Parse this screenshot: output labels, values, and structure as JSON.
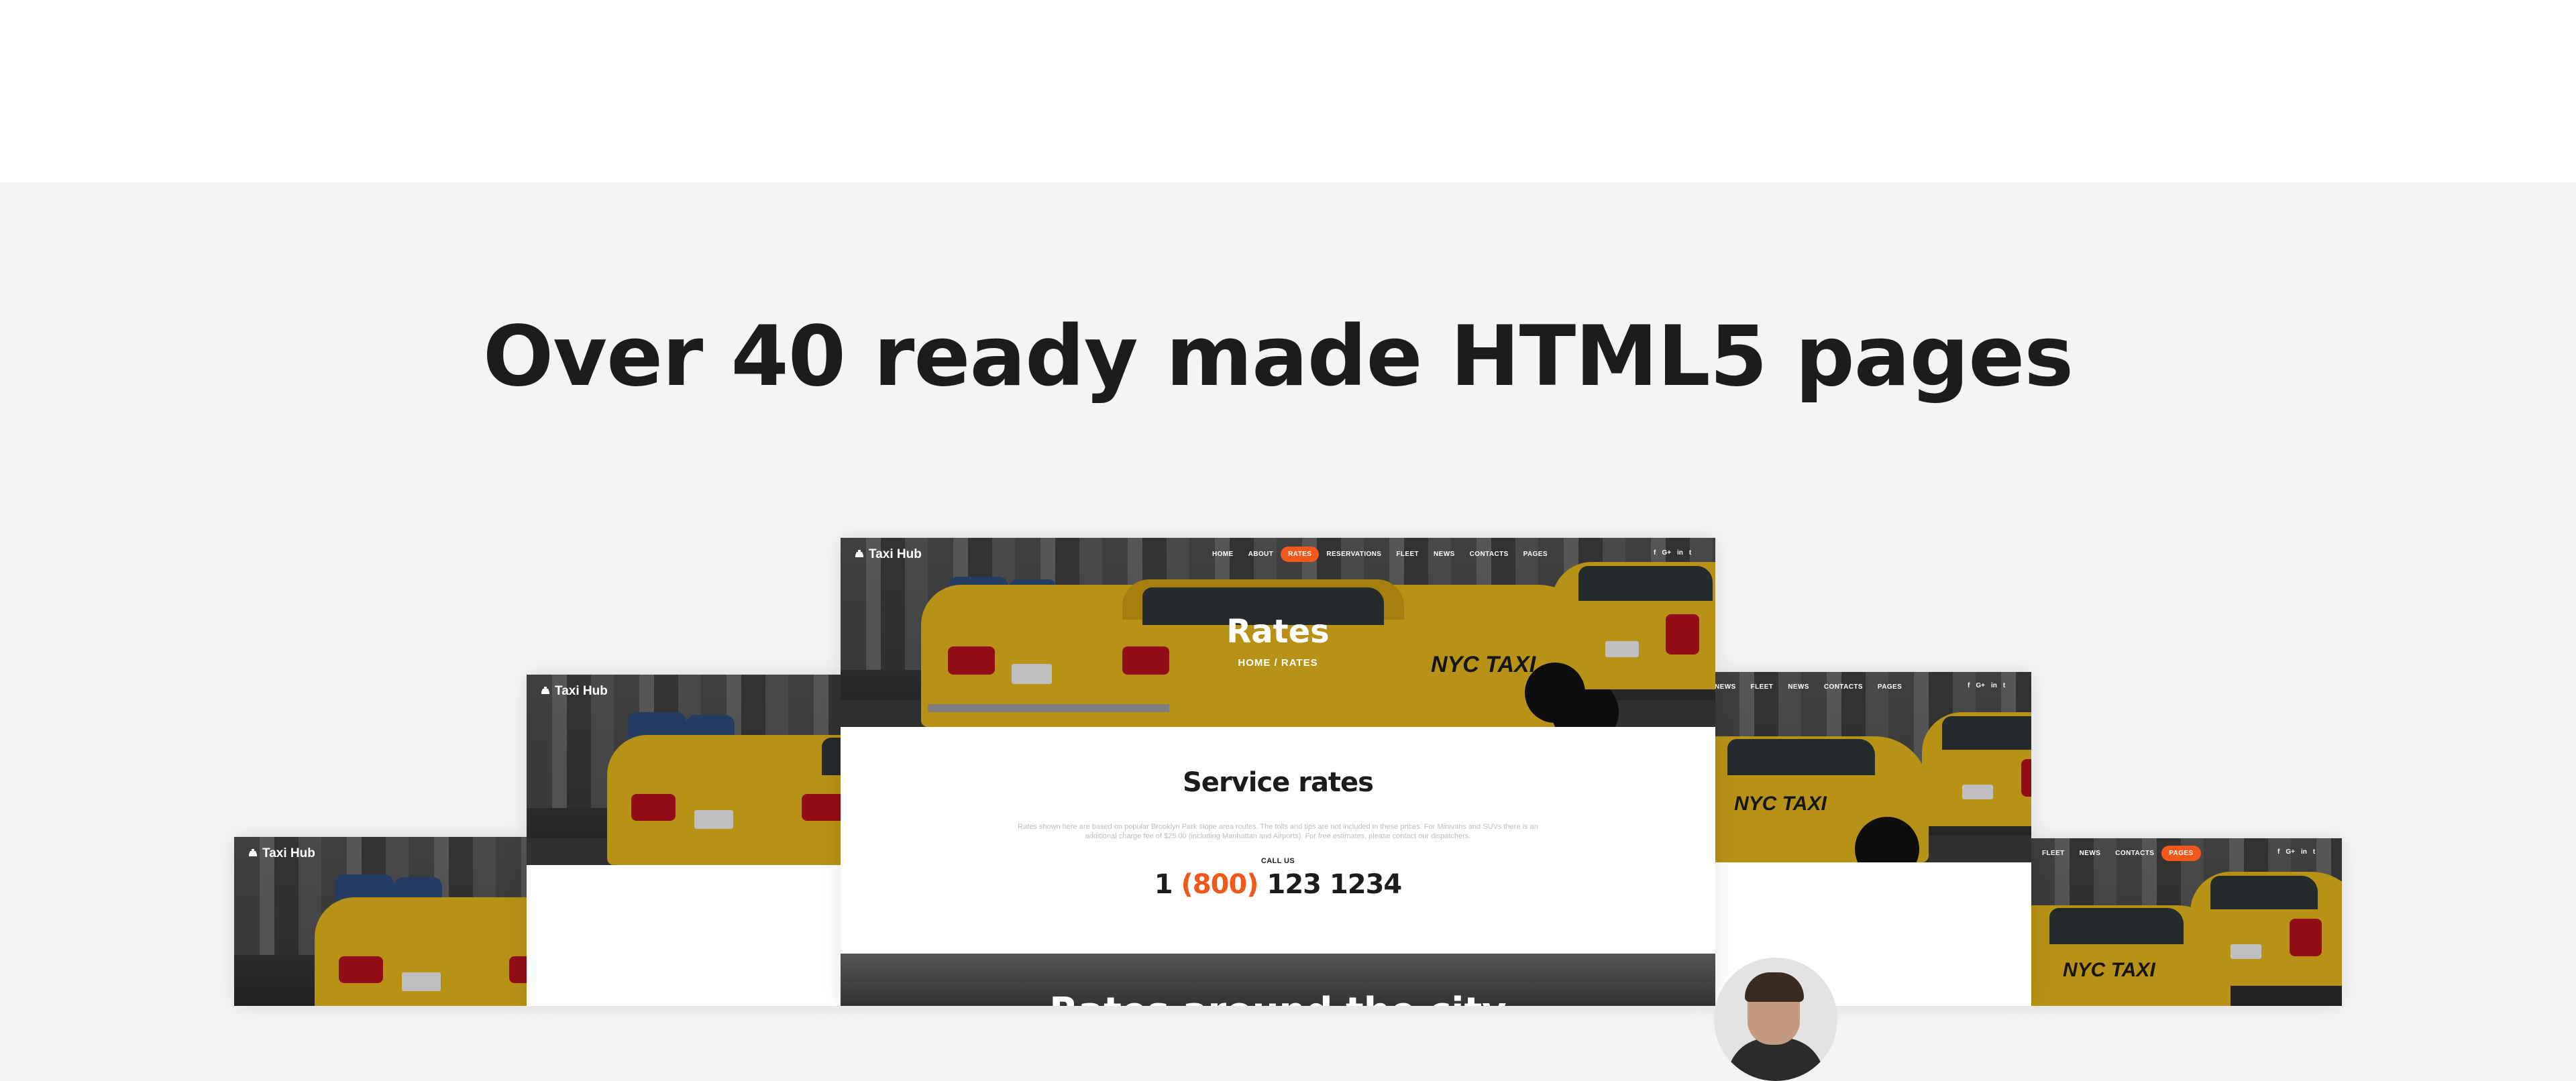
{
  "headline": "Over 40 ready made HTML5 pages",
  "brand": "Taxi Hub",
  "nav_center": [
    "HOME",
    "ABOUT",
    "RATES",
    "RESERVATIONS",
    "FLEET",
    "NEWS",
    "CONTACTS",
    "PAGES"
  ],
  "nav_active": "RATES",
  "nav_r1": [
    "NEWS",
    "FLEET",
    "NEWS",
    "CONTACTS",
    "PAGES"
  ],
  "nav_r2": [
    "FLEET",
    "NEWS",
    "CONTACTS",
    "PAGES"
  ],
  "social": [
    "f",
    "G+",
    "in",
    "t"
  ],
  "hero": {
    "title": "Rates",
    "breadcrumb": "HOME / RATES"
  },
  "service": {
    "title": "Service rates",
    "description": "Rates shown here are based on popular Brooklyn Park slope area routes. The tolls and tips are not included in these prices. For Minivans and SUVs there is an additional charge fee of $25.00 (including Manhattan and Airports). For free estimates, please contact our dispatchers.",
    "call_label": "CALL US",
    "phone_prefix": "1 ",
    "phone_area": "(800)",
    "phone_rest": " 123 1234"
  },
  "bottom_title": "Rates around the city",
  "car_logo": "NYC TAXI",
  "accent_color": "#f2581a",
  "taxi_color": "#e0b21b"
}
